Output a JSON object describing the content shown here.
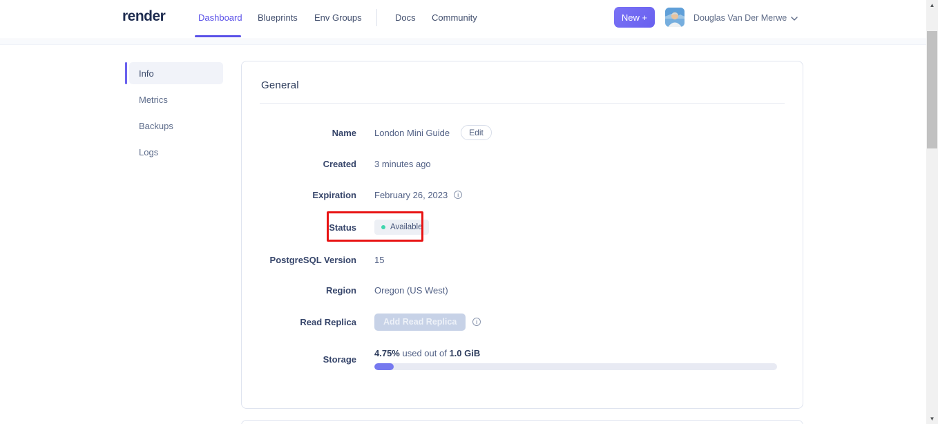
{
  "header": {
    "logo": "render",
    "nav_items": [
      {
        "label": "Dashboard",
        "active": true
      },
      {
        "label": "Blueprints",
        "active": false
      },
      {
        "label": "Env Groups",
        "active": false
      },
      {
        "label": "Docs",
        "active": false
      },
      {
        "label": "Community",
        "active": false
      }
    ],
    "new_button_label": "New +",
    "user_name": "Douglas Van Der Merwe"
  },
  "sidebar": {
    "items": [
      {
        "label": "Info",
        "active": true
      },
      {
        "label": "Metrics",
        "active": false
      },
      {
        "label": "Backups",
        "active": false
      },
      {
        "label": "Logs",
        "active": false
      }
    ]
  },
  "general_card": {
    "title": "General",
    "name_row": {
      "label": "Name",
      "value": "London Mini Guide",
      "edit_button_label": "Edit"
    },
    "created_row": {
      "label": "Created",
      "value": "3 minutes ago"
    },
    "expiration_row": {
      "label": "Expiration",
      "value": "February 26, 2023"
    },
    "status_row": {
      "label": "Status",
      "badge_label": "Available"
    },
    "version_row": {
      "label": "PostgreSQL Version",
      "value": "15"
    },
    "region_row": {
      "label": "Region",
      "value": "Oregon (US West)"
    },
    "replica_row": {
      "label": "Read Replica",
      "button_label": "Add Read Replica"
    },
    "storage_row": {
      "label": "Storage",
      "used_percent": "4.75%",
      "middle_text": " used out of ",
      "total": "1.0 GiB",
      "percent_value": 4.75
    }
  },
  "icons": {
    "info": "i"
  },
  "colors": {
    "accent_purple": "#5a51e8",
    "new_button_purple": "#6f6bf3",
    "status_dot_teal": "#3fd6ad",
    "highlight_red": "#e81414",
    "progress_fill_purple": "#7679ef"
  }
}
